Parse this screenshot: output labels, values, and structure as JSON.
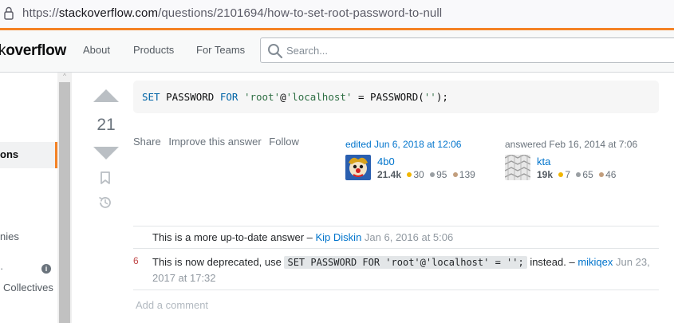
{
  "browser": {
    "url_prefix": "https://",
    "url_host": "stackoverflow.com",
    "url_path": "/questions/2101694/how-to-set-root-password-to-null"
  },
  "topbar": {
    "logo_light": "k",
    "logo_bold": "overflow",
    "nav": [
      "About",
      "Products",
      "For Teams"
    ],
    "search_placeholder": "Search..."
  },
  "sidebar": {
    "active_item": "ons",
    "item_companies": "nies",
    "item_collectives": "Collectives",
    "info_glyph": "i",
    "scroll_up_glyph": "^"
  },
  "answer": {
    "score": "21",
    "code_tokens": [
      {
        "text": "SET",
        "kind": "kw"
      },
      {
        "text": " PASSWORD ",
        "kind": "plain"
      },
      {
        "text": "FOR",
        "kind": "kw"
      },
      {
        "text": " ",
        "kind": "plain"
      },
      {
        "text": "'root'",
        "kind": "str"
      },
      {
        "text": "@",
        "kind": "plain"
      },
      {
        "text": "'localhost'",
        "kind": "str"
      },
      {
        "text": " = PASSWORD(",
        "kind": "plain"
      },
      {
        "text": "''",
        "kind": "str"
      },
      {
        "text": ");",
        "kind": "plain"
      }
    ],
    "menu": {
      "share": "Share",
      "improve": "Improve this answer",
      "follow": "Follow"
    },
    "editor": {
      "action": "edited Jun 6, 2018 at 12:06",
      "name": "4b0",
      "rep": "21.4k",
      "gold": "30",
      "silver": "95",
      "bronze": "139"
    },
    "author": {
      "action": "answered Feb 16, 2014 at 7:06",
      "name": "kta",
      "rep": "19k",
      "gold": "7",
      "silver": "65",
      "bronze": "46"
    }
  },
  "comments": [
    {
      "score": "",
      "text": "This is a more up-to-date answer",
      "sep": " – ",
      "user": "Kip Diskin",
      "date": "Jan 6, 2016 at 5:06"
    },
    {
      "score": "6",
      "text_before": "This is now deprecated, use ",
      "code": "SET PASSWORD FOR 'root'@'localhost' = '';",
      "text_after": " instead.",
      "sep": " – ",
      "user": "mikiqex",
      "date": "Jun 23, 2017 at 17:32"
    }
  ],
  "add_comment": "Add a comment",
  "colors": {
    "accent_orange": "#f48225",
    "link_blue": "#0074cc",
    "badge_gold": "#f1b600",
    "badge_silver": "#9a9fa3",
    "badge_bronze": "#c29e7d"
  }
}
